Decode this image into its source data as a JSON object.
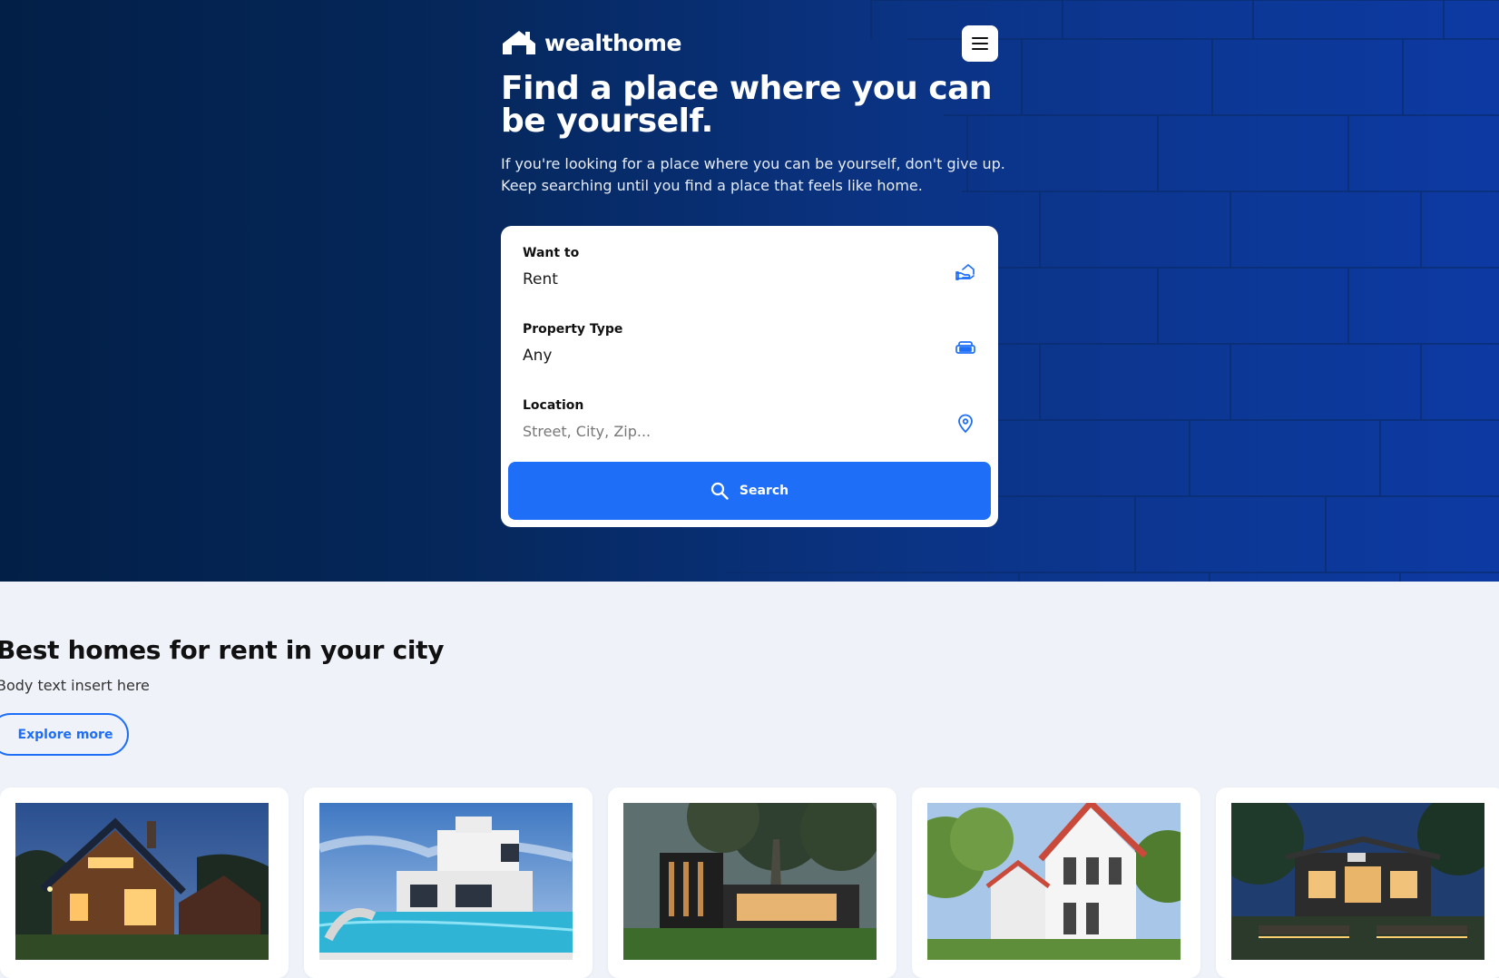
{
  "brand": {
    "name": "wealthome"
  },
  "hero": {
    "headline": "Find a place where you can be yourself.",
    "subtext": "If you're looking for a place where you can be yourself, don't give up. Keep searching until you find a place that feels like home."
  },
  "search_form": {
    "want_to": {
      "label": "Want to",
      "value": "Rent",
      "icon": "hand-house-icon"
    },
    "property_type": {
      "label": "Property Type",
      "value": "Any",
      "icon": "sofa-icon"
    },
    "location": {
      "label": "Location",
      "placeholder": "Street, City, Zip...",
      "icon": "map-pin-icon"
    },
    "search_button": {
      "label": "Search",
      "icon": "search-icon"
    }
  },
  "section": {
    "title": "Best homes for rent in your city",
    "body": "Body text insert here",
    "explore_label": "Explore more"
  },
  "listings": [
    {
      "scene": "cabin-at-dusk"
    },
    {
      "scene": "modern-villa-pool"
    },
    {
      "scene": "modern-house-tree"
    },
    {
      "scene": "white-townhouses"
    },
    {
      "scene": "house-night-garden"
    }
  ],
  "colors": {
    "accent": "#1e6ef7",
    "hero_dark": "#021f47",
    "hero_light": "#0d3aa3",
    "page_bg": "#eff3f9"
  }
}
